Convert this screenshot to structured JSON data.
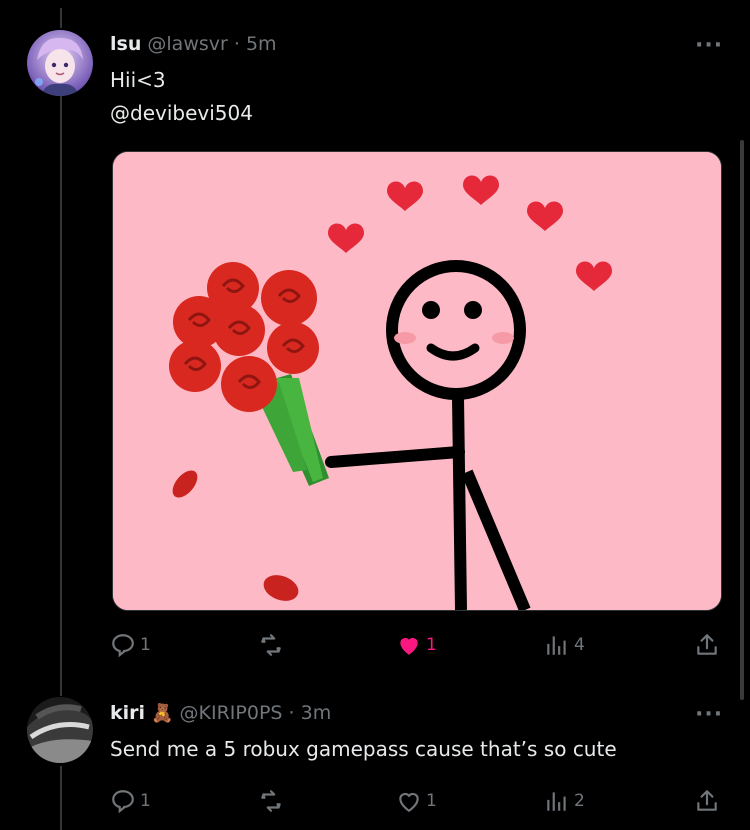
{
  "post": {
    "display_name": "lsu",
    "handle": "@lawsvr",
    "time": "· 5m",
    "text_line1": "Hii<3",
    "text_line2": "@devibevi504",
    "more_label": "···",
    "actions": {
      "replies": "1",
      "reposts": "",
      "likes": "1",
      "views": "4"
    },
    "liked": true
  },
  "reply": {
    "display_name": "kiri",
    "name_emoji": "🧸",
    "handle": "@KIRIP0PS",
    "time": "· 3m",
    "text": "Send me a 5 robux gamepass cause that’s so cute",
    "more_label": "···",
    "actions": {
      "replies": "1",
      "reposts": "",
      "likes": "1",
      "views": "2"
    },
    "liked": false
  },
  "colors": {
    "background": "#000000",
    "text": "#e7e9ea",
    "muted": "#71767b",
    "like_active": "#f91880",
    "media_bg": "#fdb9c5"
  },
  "icons": [
    "reply-icon",
    "repost-icon",
    "heart-icon",
    "views-icon",
    "share-icon",
    "more-icon"
  ]
}
